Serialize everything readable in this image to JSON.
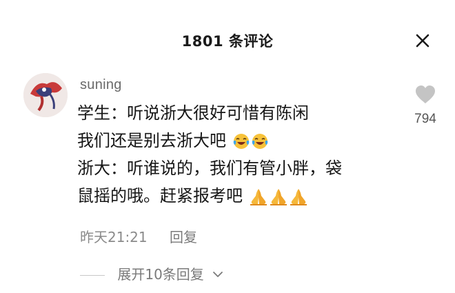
{
  "header": {
    "title": "1801 条评论",
    "close_icon": "close-icon"
  },
  "comment": {
    "username": "suning",
    "lines": [
      "学生：听说浙大很好可惜有陈闲",
      "我们还是别去浙大吧",
      "浙大：听谁说的，我们有管小胖，袋",
      "鼠摇的哦。赶紧报考吧"
    ],
    "emojis": {
      "line2": [
        "laughing-tears-emoji",
        "laughing-tears-emoji"
      ],
      "line4": [
        "praying-hands-emoji",
        "praying-hands-emoji",
        "praying-hands-emoji"
      ]
    },
    "like_count": "794",
    "time": "昨天21:21",
    "reply_label": "回复",
    "expand_label": "展开10条回复"
  },
  "colors": {
    "text": "#161616",
    "muted": "#8a8a8a",
    "username": "#6a6a6a",
    "heart": "#c4c4c4",
    "emoji_face": "#f7c23a",
    "emoji_tears": "#3ea6ea"
  }
}
